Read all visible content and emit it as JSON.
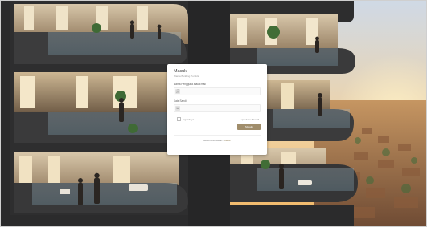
{
  "login": {
    "title": "Masuk",
    "subtitle": "Warna Building Portfolio",
    "username_label": "Nama Pengguna atau Email",
    "username_value": "",
    "password_label": "Kata Sandi",
    "password_value": "",
    "remember_label": "Ingat Saya",
    "forgot_label": "Lupa Kata Sandi?",
    "submit_label": "Masuk",
    "register_prompt": "Belum mendaftar?",
    "register_link": "Daftar"
  },
  "icons": {
    "username": "user-icon",
    "password": "key-icon"
  },
  "colors": {
    "accent": "#a08d6b",
    "card_background": "#ffffff"
  }
}
